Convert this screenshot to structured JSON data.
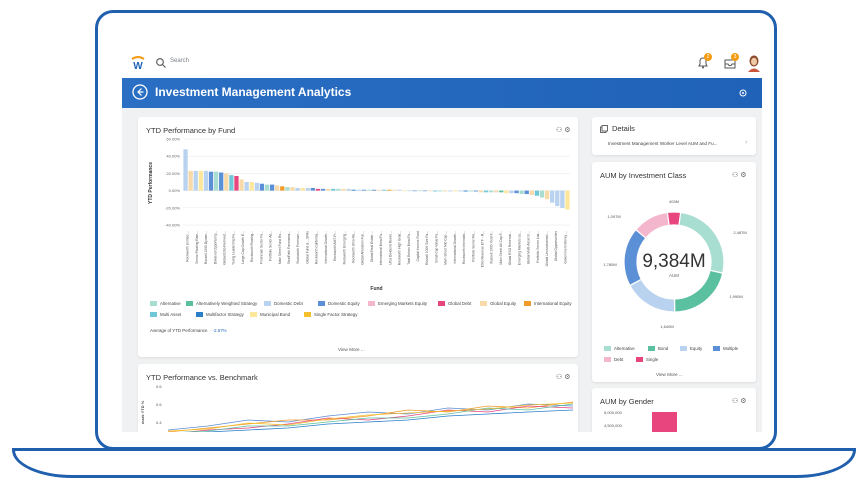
{
  "topbar": {
    "search_placeholder": "Search",
    "bell_badge": "2",
    "inbox_badge": "3"
  },
  "header": {
    "title": "Investment Management Analytics"
  },
  "ytd_by_fund": {
    "title": "YTD Performance by Fund",
    "y_ticks": [
      "60.00%",
      "40.00%",
      "20.00%",
      "0.00%",
      "-20.00%",
      "-40.00%"
    ],
    "ylabel": "YTD Performance",
    "xlabel": "Fund",
    "fund_labels": [
      "Rockworth Limited ...",
      "Senior Floating Rate...",
      "Russell 1000 Dynam...",
      "Dividend Opportunity...",
      "Global ESG Reinvest...",
      "Young Leadership Fu...",
      "Large Cap Growth E...",
      "Rockworth Floating...",
      "Financials Sector Fu...",
      "Portfolio Senior Ad...",
      "Main Street Fund Ro...",
      "SteelPath Panorama...",
      "Rockworth Premium...",
      "Global Fund & ...SPAs",
      "Rockworth California...",
      "International Growth...",
      "Rockworth AMT-Fr...",
      "Rockworth Emerging...",
      "Rockworth Ohio Mu...",
      "Global Allocation Fun...",
      "Global Real Estate ...",
      "International Bond Fu...",
      "Ultra Dividend Reven...",
      "Rockworth High Grad...",
      "Total Return Bond Fu...",
      "Capital Income Fund",
      "Russell 1000 Size Fa...",
      "Small Cap Value Fu...",
      "Main Street Mid Cap ...",
      "International Growth...",
      "Rockworth Internatio...",
      "Portfolio Senior Flo...",
      "ESG Revenue ETF - R...",
      "Russell 1000 Yield F...",
      "Main Street All Cap F...",
      "Global ESG Revenue...",
      "Emerging Markets Lo...",
      "Global Multi-Asset In...",
      "Portfolio Senior Loa...",
      "Global Unconstrained ...",
      "Global Opportunities",
      "Government Money ..."
    ],
    "legend": [
      {
        "label": "Alternative",
        "color": "#a8ddd1"
      },
      {
        "label": "Alternatively Weighted Strategy",
        "color": "#5bc0a0"
      },
      {
        "label": "Domestic Debt",
        "color": "#b8d2ef"
      },
      {
        "label": "Domestic Equity",
        "color": "#5b8fd6"
      },
      {
        "label": "Emerging Markets Equity",
        "color": "#f4b6cc"
      },
      {
        "label": "Global Debt",
        "color": "#e8457f"
      },
      {
        "label": "Global Equity",
        "color": "#f8d9a8"
      },
      {
        "label": "International Equity",
        "color": "#f39a2c"
      },
      {
        "label": "Multi Asset",
        "color": "#6fc7d8"
      },
      {
        "label": "Multifactor Strategy",
        "color": "#2b7fc9"
      },
      {
        "label": "Municipal Bond",
        "color": "#fde79a"
      },
      {
        "label": "Single Factor Strategy",
        "color": "#f5c02d"
      }
    ],
    "average_label": "Average of YTD Performance",
    "average_value": "-2.57%",
    "view_more": "View More ..."
  },
  "chart_data": [
    {
      "type": "bar",
      "title": "YTD Performance by Fund",
      "xlabel": "Fund",
      "ylabel": "YTD Performance",
      "ylim": [
        -40,
        60
      ],
      "values": [
        48,
        23,
        23,
        23,
        23,
        22,
        22,
        21,
        20,
        18,
        17,
        13,
        10,
        10,
        9,
        8,
        7,
        7,
        6,
        5,
        4,
        4,
        3,
        3,
        3,
        3,
        2,
        2,
        2,
        2,
        2,
        2,
        2,
        1,
        1,
        1,
        1,
        1,
        1,
        1,
        1,
        1,
        1,
        0,
        0,
        0,
        0,
        0,
        0,
        -1,
        -1,
        -1,
        -1,
        -1,
        -1,
        -1,
        -1,
        -1,
        -2,
        -2,
        -2,
        -2,
        -2,
        -3,
        -3,
        -3,
        -4,
        -4,
        -5,
        -6,
        -8,
        -10,
        -14,
        -18,
        -20,
        -22
      ]
    },
    {
      "type": "pie",
      "title": "AUM by Investment Class",
      "center_value": "9,384M",
      "center_label": "AUM",
      "slices": [
        {
          "label": "Alternative",
          "value": 2487
        },
        {
          "label": "Bond",
          "value": 1990
        },
        {
          "label": "Equity",
          "value": 1640
        },
        {
          "label": "Multiple",
          "value": 1780
        },
        {
          "label": "Debt",
          "value": 1097
        },
        {
          "label": "Single",
          "value": 403
        }
      ],
      "slice_labels": [
        "403M",
        "2,487M",
        "1,990M",
        "1,640M",
        "1,780M",
        "1,097M"
      ]
    }
  ],
  "details": {
    "title": "Details",
    "link_text": "Investment Management Worker Level AUM and Fu..."
  },
  "aum_class": {
    "title": "AUM by Investment Class",
    "center_value": "9,384M",
    "center_label": "AUM",
    "legend": [
      {
        "label": "Alternative",
        "color": "#a8ddd1"
      },
      {
        "label": "Bond",
        "color": "#5bc0a0"
      },
      {
        "label": "Equity",
        "color": "#b8d2ef"
      },
      {
        "label": "Multiple",
        "color": "#5b8fd6"
      },
      {
        "label": "Debt",
        "color": "#f4b6cc"
      },
      {
        "label": "Single",
        "color": "#e8457f"
      }
    ],
    "view_more": "View More ..."
  },
  "vs_benchmark": {
    "title": "YTD Performance vs. Benchmark",
    "y_ticks": [
      "0.6",
      "0.6",
      "0.4"
    ],
    "ylabel": "mark YTD %"
  },
  "aum_gender": {
    "title": "AUM by Gender",
    "y_ticks": [
      "5,000,000",
      "4,500,000"
    ]
  },
  "colors": {
    "brand_blue": "#1f62b8",
    "accent_orange": "#f39c12"
  }
}
